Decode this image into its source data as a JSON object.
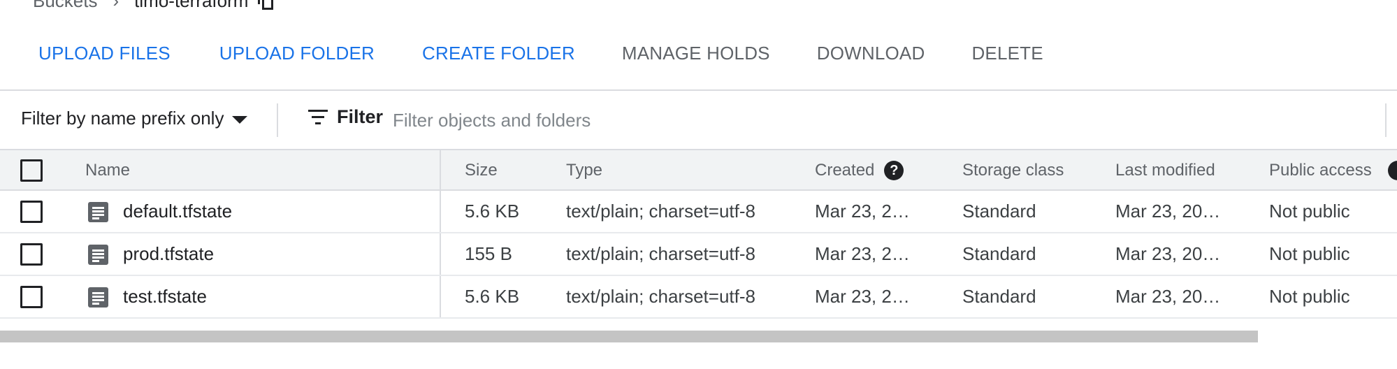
{
  "breadcrumb": {
    "parent": "Buckets",
    "separator": "›",
    "current": "timo-terraform"
  },
  "toolbar": {
    "upload_files": "UPLOAD FILES",
    "upload_folder": "UPLOAD FOLDER",
    "create_folder": "CREATE FOLDER",
    "manage_holds": "MANAGE HOLDS",
    "download": "DOWNLOAD",
    "delete": "DELETE"
  },
  "filter": {
    "prefix_select": "Filter by name prefix only",
    "filter_label": "Filter",
    "placeholder": "Filter objects and folders"
  },
  "table": {
    "columns": {
      "name": "Name",
      "size": "Size",
      "type": "Type",
      "created": "Created",
      "storage_class": "Storage class",
      "last_modified": "Last modified",
      "public_access": "Public access"
    },
    "rows": [
      {
        "name": "default.tfstate",
        "size": "5.6 KB",
        "type": "text/plain; charset=utf-8",
        "created": "Mar 23, 2…",
        "storage_class": "Standard",
        "last_modified": "Mar 23, 20…",
        "public_access": "Not public"
      },
      {
        "name": "prod.tfstate",
        "size": "155 B",
        "type": "text/plain; charset=utf-8",
        "created": "Mar 23, 2…",
        "storage_class": "Standard",
        "last_modified": "Mar 23, 20…",
        "public_access": "Not public"
      },
      {
        "name": "test.tfstate",
        "size": "5.6 KB",
        "type": "text/plain; charset=utf-8",
        "created": "Mar 23, 2…",
        "storage_class": "Standard",
        "last_modified": "Mar 23, 20…",
        "public_access": "Not public"
      }
    ]
  },
  "icons": {
    "copy": "copy-icon",
    "filter": "filter-list-icon",
    "dropdown": "arrow-drop-down-icon",
    "file": "document-icon",
    "help": "help-icon"
  },
  "colors": {
    "accent": "#1a73e8",
    "disabled_text": "#5f6368",
    "header_bg": "#f1f3f4",
    "divider": "#dadce0"
  },
  "help_glyph": "?"
}
